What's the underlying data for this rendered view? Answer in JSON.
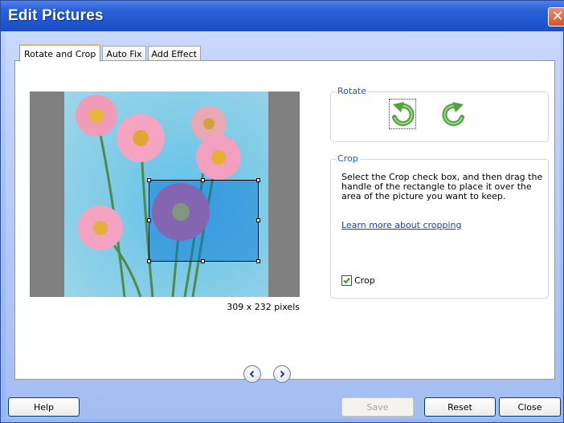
{
  "window": {
    "title": "Edit Pictures",
    "close_glyph": "✕"
  },
  "tabs": [
    {
      "label": "Rotate and Crop",
      "active": true
    },
    {
      "label": "Auto Fix",
      "active": false
    },
    {
      "label": "Add Effect",
      "active": false
    }
  ],
  "picture": {
    "size_label": "309 x 232 pixels"
  },
  "rotate": {
    "legend": "Rotate",
    "left_icon": "rotate-left-icon",
    "right_icon": "rotate-right-icon"
  },
  "crop": {
    "legend": "Crop",
    "description": "Select the Crop check box, and then drag the handle of the rectangle to place it over the area of the picture you want to keep.",
    "link": "Learn more about cropping",
    "checkbox_label": "Crop",
    "checked": true
  },
  "nav": {
    "prev_icon": "chevron-left-icon",
    "next_icon": "chevron-right-icon"
  },
  "buttons": {
    "help": "Help",
    "save": "Save",
    "reset": "Reset",
    "close": "Close"
  },
  "colors": {
    "title_bar": "#2a62da",
    "accent_link": "#1a3fb4",
    "group_legend": "#1b58c6",
    "rotate_green": "#4ea33a"
  }
}
